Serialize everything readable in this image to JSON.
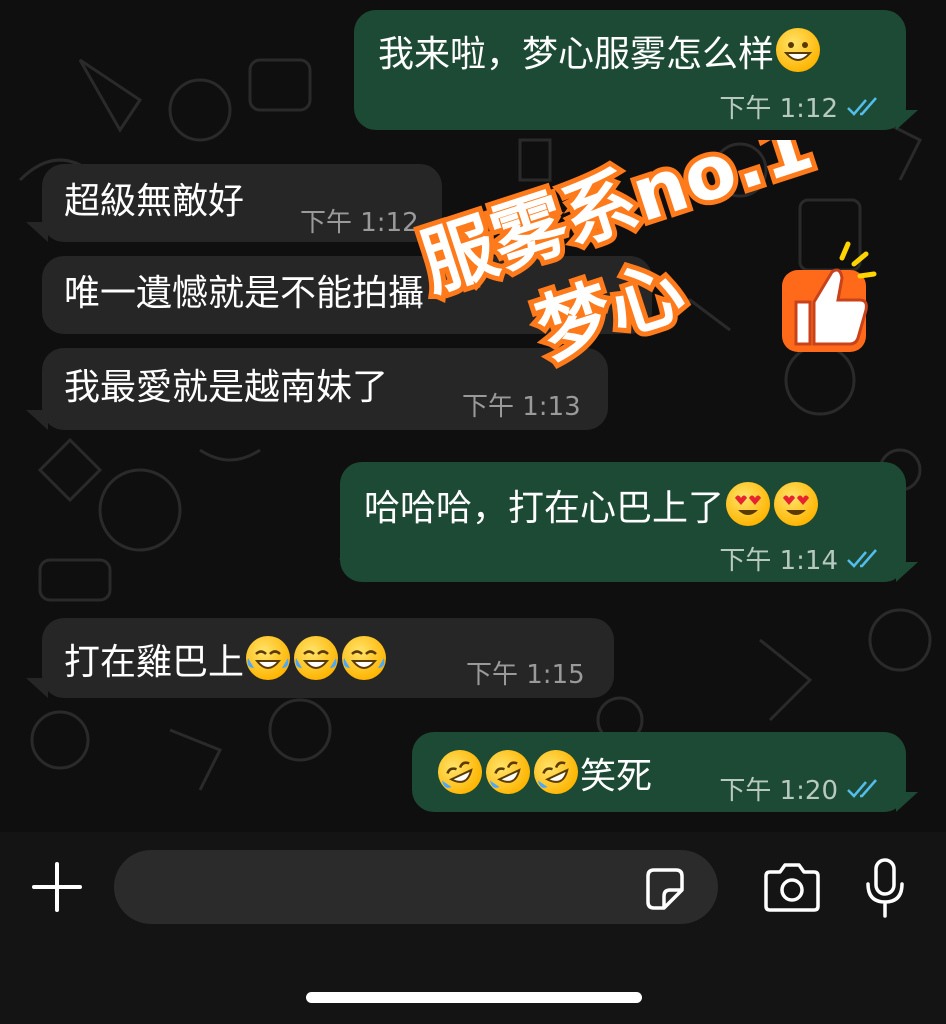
{
  "messages": [
    {
      "direction": "out",
      "text": "我来啦，梦心服雾怎么样",
      "emoji": [
        "grinning-face"
      ],
      "time": "下午 1:12",
      "read": true
    },
    {
      "direction": "in",
      "text": "超級無敵好",
      "time": "下午 1:12"
    },
    {
      "direction": "in",
      "text": "唯一遺憾就是不能拍攝",
      "time": ""
    },
    {
      "direction": "in",
      "text": "我最愛就是越南妹了",
      "time": "下午 1:13"
    },
    {
      "direction": "out",
      "text": "哈哈哈，打在心巴上了",
      "emoji": [
        "heart-eyes-face",
        "heart-eyes-face"
      ],
      "time": "下午 1:14",
      "read": true
    },
    {
      "direction": "in",
      "text": "打在雞巴上",
      "emoji": [
        "tears-of-joy-face",
        "tears-of-joy-face",
        "tears-of-joy-face"
      ],
      "time": "下午 1:15"
    },
    {
      "direction": "out",
      "text": "笑死",
      "emoji_before": [
        "rofl-face",
        "rofl-face",
        "rofl-face"
      ],
      "time": "下午 1:20",
      "read": true
    }
  ],
  "sticker": {
    "line1": "服雾系no.1",
    "line2": "梦心",
    "icon": "thumbs-up-icon"
  },
  "input": {
    "placeholder": "",
    "icons": [
      "plus-icon",
      "sticker-icon",
      "camera-icon",
      "microphone-icon"
    ]
  },
  "colors": {
    "incoming_bubble": "#262626",
    "outgoing_bubble": "#1d4a34",
    "read_ticks": "#53bdeb",
    "sticker_orange": "#ff6a1a"
  }
}
